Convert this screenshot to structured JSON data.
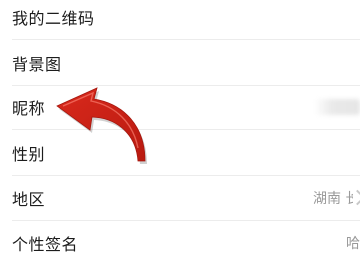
{
  "settings": {
    "rows": [
      {
        "label": "我的二维码"
      },
      {
        "label": "背景图"
      },
      {
        "label": "昵称"
      },
      {
        "label": "性别"
      },
      {
        "label": "地区",
        "value": "湖南 长"
      },
      {
        "label": "个性签名",
        "value": "哈"
      }
    ]
  },
  "annotation": {
    "arrow_color": "#d9291c",
    "icon": "curved-arrow-pointing-left"
  }
}
